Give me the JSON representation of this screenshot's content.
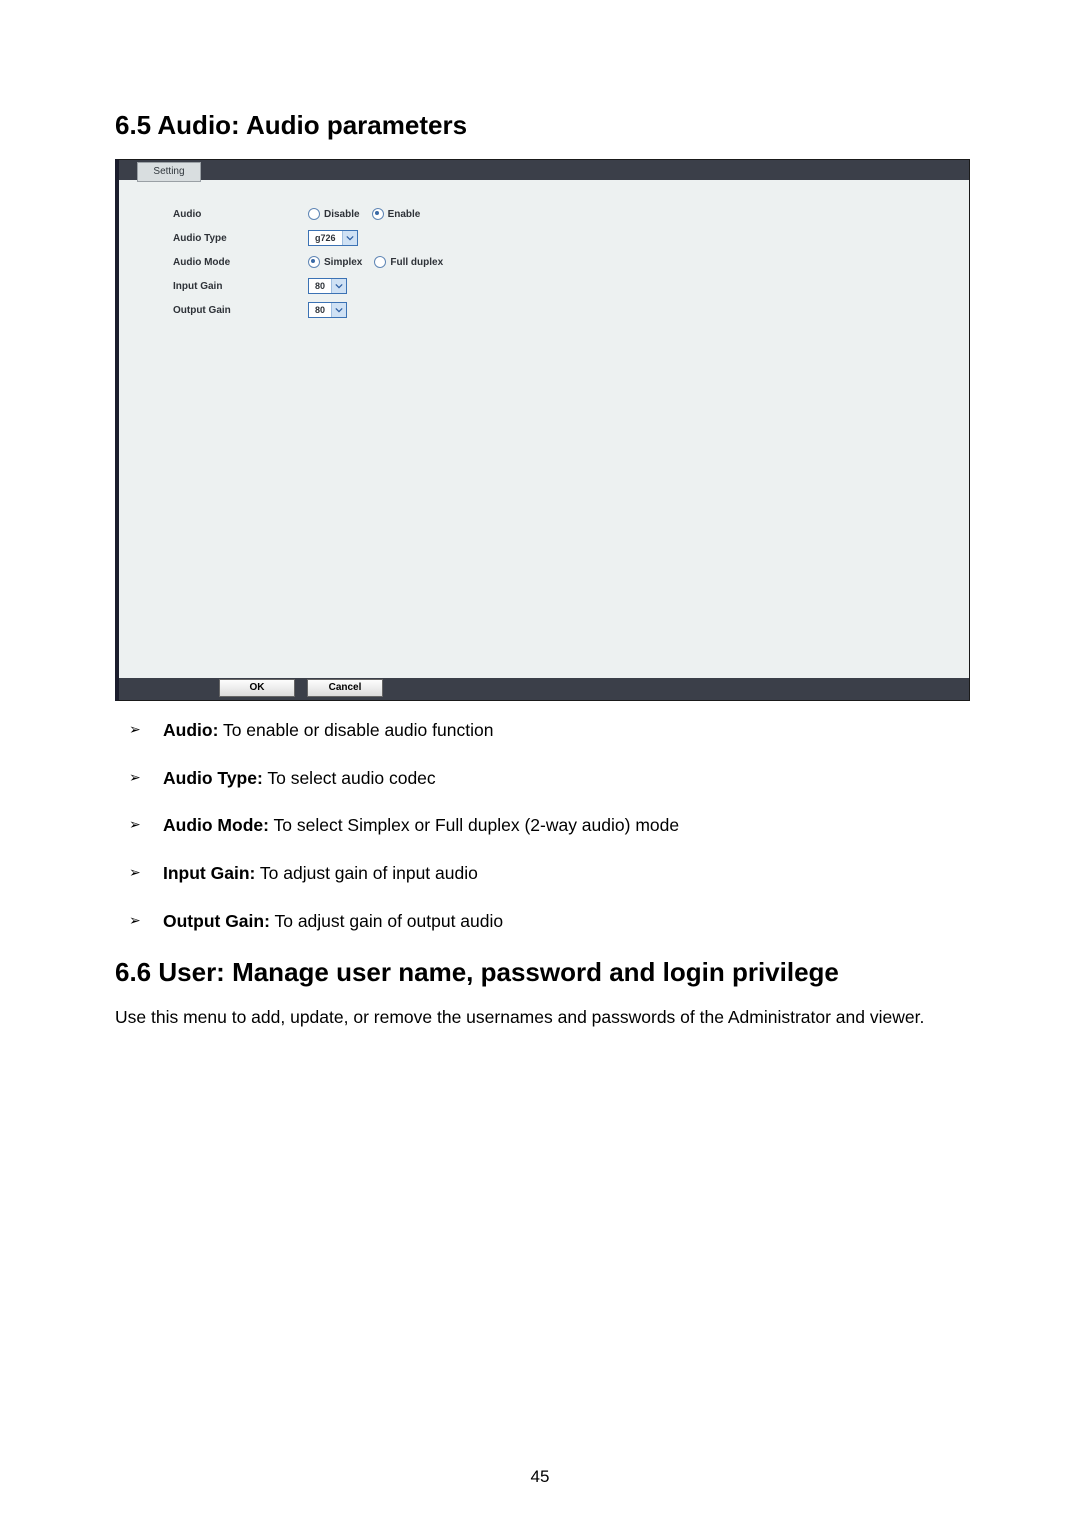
{
  "section65": {
    "heading": "6.5  Audio: Audio parameters",
    "tab": "Setting",
    "rows": {
      "audio": {
        "label": "Audio",
        "opt1": "Disable",
        "opt2": "Enable",
        "selected": "Enable"
      },
      "audio_type": {
        "label": "Audio Type",
        "value": "g726"
      },
      "audio_mode": {
        "label": "Audio Mode",
        "opt1": "Simplex",
        "opt2": "Full duplex",
        "selected": "Simplex"
      },
      "input_gain": {
        "label": "Input Gain",
        "value": "80"
      },
      "output_gain": {
        "label": "Output Gain",
        "value": "80"
      }
    },
    "buttons": {
      "ok": "OK",
      "cancel": "Cancel"
    }
  },
  "bullets": [
    {
      "b": "Audio:",
      "t": " To enable or disable audio function"
    },
    {
      "b": "Audio Type:",
      "t": " To select audio codec"
    },
    {
      "b": "Audio Mode:",
      "t": " To select Simplex or Full duplex (2-way audio) mode"
    },
    {
      "b": "Input Gain:",
      "t": " To adjust gain of input audio"
    },
    {
      "b": "Output Gain:",
      "t": " To adjust gain of output audio"
    }
  ],
  "section66": {
    "heading": "6.6  User: Manage user name, password and login privilege",
    "body": "Use this menu to add, update, or remove the usernames and passwords of the Administrator and viewer."
  },
  "page_number": "45"
}
